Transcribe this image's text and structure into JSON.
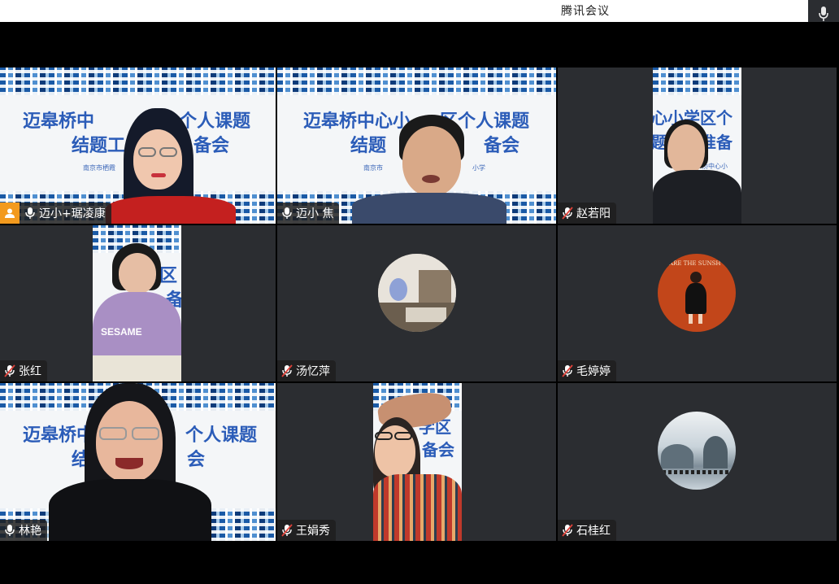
{
  "app": {
    "title": "腾讯会议"
  },
  "participants": [
    {
      "name": "迈小+琚凌康",
      "muted": false,
      "tag": "host"
    },
    {
      "name": "迈小 焦",
      "muted": false
    },
    {
      "name": "赵若阳",
      "muted": true
    },
    {
      "name": "张红",
      "muted": true
    },
    {
      "name": "汤忆萍",
      "muted": true
    },
    {
      "name": "毛婷婷",
      "muted": true
    },
    {
      "name": "林艳",
      "muted": false
    },
    {
      "name": "王娟秀",
      "muted": true
    },
    {
      "name": "石桂红",
      "muted": true
    }
  ],
  "banner": {
    "line1": "迈皋桥中心小学区个人课题",
    "line2": "结题工作筹备会",
    "line1_part_a": "迈皋桥中",
    "line1_part_b": "个人课题",
    "line2_part_a": "结题工",
    "line2_part_b": "备会",
    "line1_tile2_a": "迈皋桥中心小",
    "line1_tile2_b": "区个人课题",
    "line2_tile2_a": "结题",
    "line2_tile2_b": "备会",
    "line1_tile3": "心小学区个",
    "line2_tile3": "题工作准备",
    "line1_tile7_a": "迈皋桥中",
    "line1_tile7_b": "个人课题",
    "line2_tile7_a": "结",
    "line2_tile7_b": "会",
    "school_tile1": "南京市栖霞",
    "school_tile2_a": "南京市",
    "school_tile2_b": "小学",
    "school_tile3": "皋桥中心小",
    "tile4_c1": "区",
    "tile4_c2": "备",
    "tile8_a": "学区",
    "tile8_b": "备会"
  },
  "avatar_text": {
    "sunshine": "ARE THE SUNSH"
  },
  "colors": {
    "tile_bg": "#2b2d31",
    "speaking": "#2ecc71",
    "badge": "#f39a1e",
    "muted_mic": "#e0423a"
  }
}
